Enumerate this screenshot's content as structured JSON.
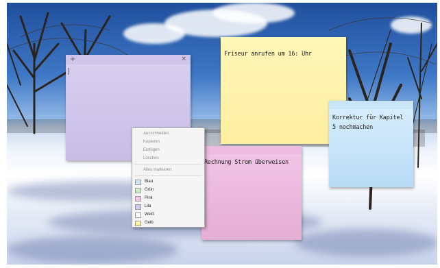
{
  "notes": {
    "purple": {
      "text": "",
      "color": "#cbc0e8",
      "new_icon": "+",
      "close_icon": "×"
    },
    "yellow": {
      "text": "Friseur anrufen um 16: Uhr",
      "color": "#fff3ad"
    },
    "blue": {
      "text": "Korrektur für Kapitel 5 nochmachen",
      "color": "#cbe6fa"
    },
    "pink": {
      "text": "Rechnung Strom überweisen",
      "color": "#ecbadf"
    }
  },
  "context_menu": {
    "items": [
      "Ausschneiden",
      "Kopieren",
      "Einfügen",
      "Löschen"
    ],
    "select_all": "Alles markieren",
    "colors": [
      {
        "label": "Blau",
        "hex": "#cfe8fb"
      },
      {
        "label": "Grün",
        "hex": "#cdeec8"
      },
      {
        "label": "Pink",
        "hex": "#f0c2e4"
      },
      {
        "label": "Lila",
        "hex": "#d3c8ee"
      },
      {
        "label": "Weiß",
        "hex": "#ffffff"
      },
      {
        "label": "Gelb",
        "hex": "#fff3ad"
      }
    ]
  }
}
